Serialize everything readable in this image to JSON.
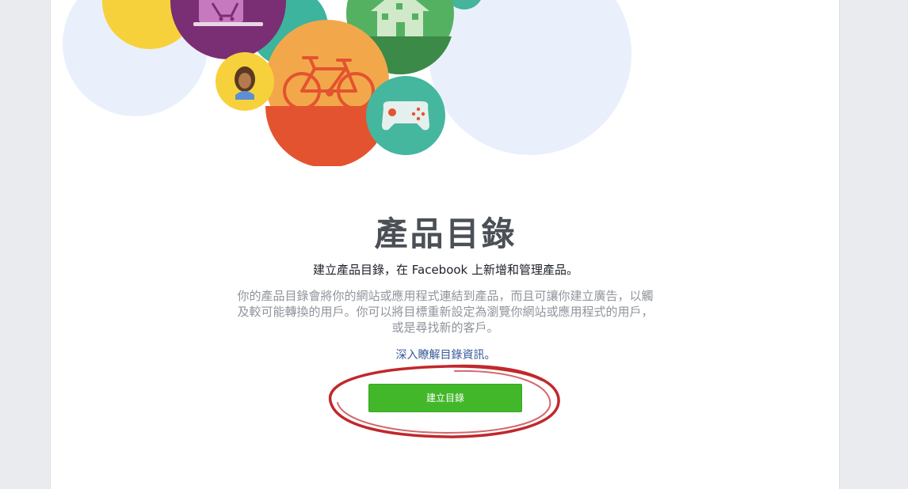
{
  "page": {
    "title": "產品目錄",
    "subtitle": "建立產品目錄，在 Facebook 上新增和管理產品。",
    "description": [
      "你的產品目錄會將你的網站或應用程式連結到產品，而且可讓你建立廣告，以觸",
      "及較可能轉換的用戶。你可以將目標重新設定為瀏覽你網站或應用程式的用戶，",
      "或是尋找新的客戶。"
    ],
    "learn_more_link": "深入瞭解目錄資訊。",
    "create_button": "建立目錄"
  },
  "illustration": {
    "icons": [
      "shopping-cart-icon",
      "house-icon",
      "bicycle-icon",
      "person-avatar-icon",
      "game-controller-icon"
    ]
  },
  "colors": {
    "button_green": "#42b72a",
    "link_blue": "#365899",
    "annotation_red": "#c0282d"
  }
}
